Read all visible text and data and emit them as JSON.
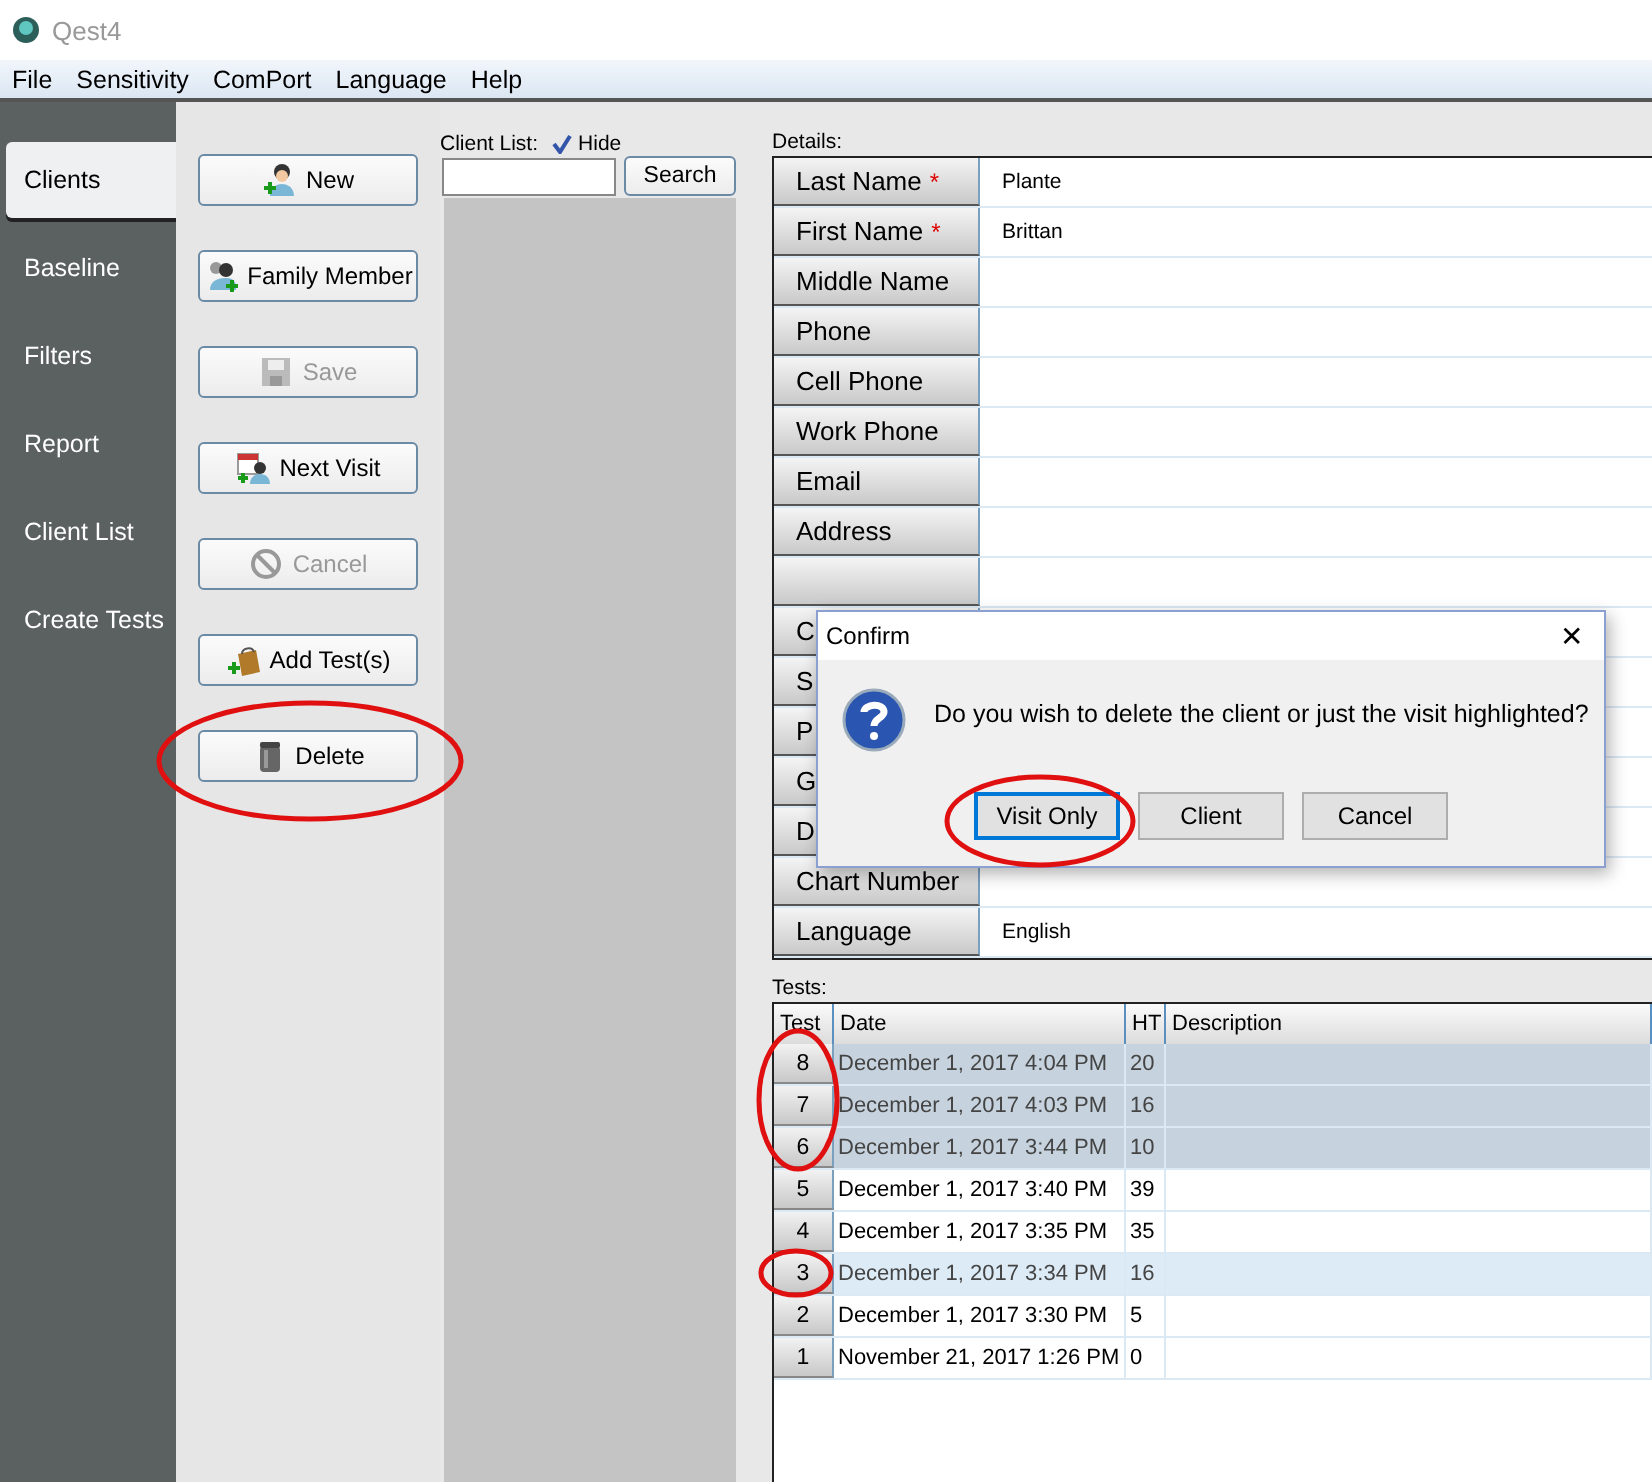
{
  "window": {
    "title": "Qest4"
  },
  "menu": [
    "File",
    "Sensitivity",
    "ComPort",
    "Language",
    "Help"
  ],
  "nav": [
    {
      "label": "Clients",
      "selected": true
    },
    {
      "label": "Baseline",
      "selected": false
    },
    {
      "label": "Filters",
      "selected": false
    },
    {
      "label": "Report",
      "selected": false
    },
    {
      "label": "Client List",
      "selected": false
    },
    {
      "label": "Create Tests",
      "selected": false
    }
  ],
  "actions": [
    {
      "label": "New",
      "kind": "new",
      "disabled": false
    },
    {
      "label": "Family Member",
      "kind": "family",
      "disabled": false
    },
    {
      "label": "Save",
      "kind": "save",
      "disabled": true
    },
    {
      "label": "Next Visit",
      "kind": "visit",
      "disabled": false
    },
    {
      "label": "Cancel",
      "kind": "cancel",
      "disabled": true
    },
    {
      "label": "Add Test(s)",
      "kind": "add",
      "disabled": false
    },
    {
      "label": "Delete",
      "kind": "delete",
      "disabled": false
    }
  ],
  "client_list": {
    "label": "Client List:",
    "hide_label": "Hide",
    "hide_checked": true,
    "search_button": "Search"
  },
  "details": {
    "label": "Details:",
    "fields": [
      {
        "kind": "field",
        "label": "Last Name",
        "marker": "*",
        "value": "Plante"
      },
      {
        "kind": "field",
        "label": "First Name",
        "marker": "*",
        "value": "Brittan"
      },
      {
        "kind": "field",
        "label": "Middle Name"
      },
      {
        "kind": "field",
        "label": "Phone"
      },
      {
        "kind": "field",
        "label": "Cell Phone"
      },
      {
        "kind": "field",
        "label": "Work Phone"
      },
      {
        "kind": "field",
        "label": "Email"
      },
      {
        "kind": "field",
        "label": "Address"
      },
      {
        "kind": "blank"
      },
      {
        "kind": "field",
        "label": "C"
      },
      {
        "kind": "field",
        "label": "S"
      },
      {
        "kind": "field",
        "label": "P"
      },
      {
        "kind": "field",
        "label": "G"
      },
      {
        "kind": "field",
        "label": "D"
      },
      {
        "kind": "field",
        "label": "Chart Number"
      },
      {
        "kind": "field",
        "label": "Language",
        "value": "English"
      }
    ]
  },
  "tests": {
    "label": "Tests:",
    "columns": [
      "Test",
      "Date",
      "HT",
      "Description"
    ],
    "rows": [
      {
        "test": "8",
        "date": "December 1, 2017  4:04 PM",
        "ht": "20",
        "selected": true,
        "highlighted": false
      },
      {
        "test": "7",
        "date": "December 1, 2017  4:03 PM",
        "ht": "16",
        "selected": true,
        "highlighted": false
      },
      {
        "test": "6",
        "date": "December 1, 2017  3:44 PM",
        "ht": "10",
        "selected": true,
        "highlighted": false
      },
      {
        "test": "5",
        "date": "December 1, 2017  3:40 PM",
        "ht": "39",
        "selected": false,
        "highlighted": false
      },
      {
        "test": "4",
        "date": "December 1, 2017  3:35 PM",
        "ht": "35",
        "selected": false,
        "highlighted": false
      },
      {
        "test": "3",
        "date": "December 1, 2017  3:34 PM",
        "ht": "16",
        "selected": false,
        "highlighted": true
      },
      {
        "test": "2",
        "date": "December 1, 2017  3:30 PM",
        "ht": "5",
        "selected": false,
        "highlighted": false
      },
      {
        "test": "1",
        "date": "November 21, 2017  1:26 PM",
        "ht": "0",
        "selected": false,
        "highlighted": false
      }
    ]
  },
  "dialog": {
    "title": "Confirm",
    "close": "✕",
    "message": "Do you wish to delete the client or just the visit highlighted?",
    "buttons": [
      {
        "label": "Visit Only",
        "selected": true
      },
      {
        "label": "Client",
        "selected": false
      },
      {
        "label": "Cancel",
        "selected": false
      }
    ]
  }
}
